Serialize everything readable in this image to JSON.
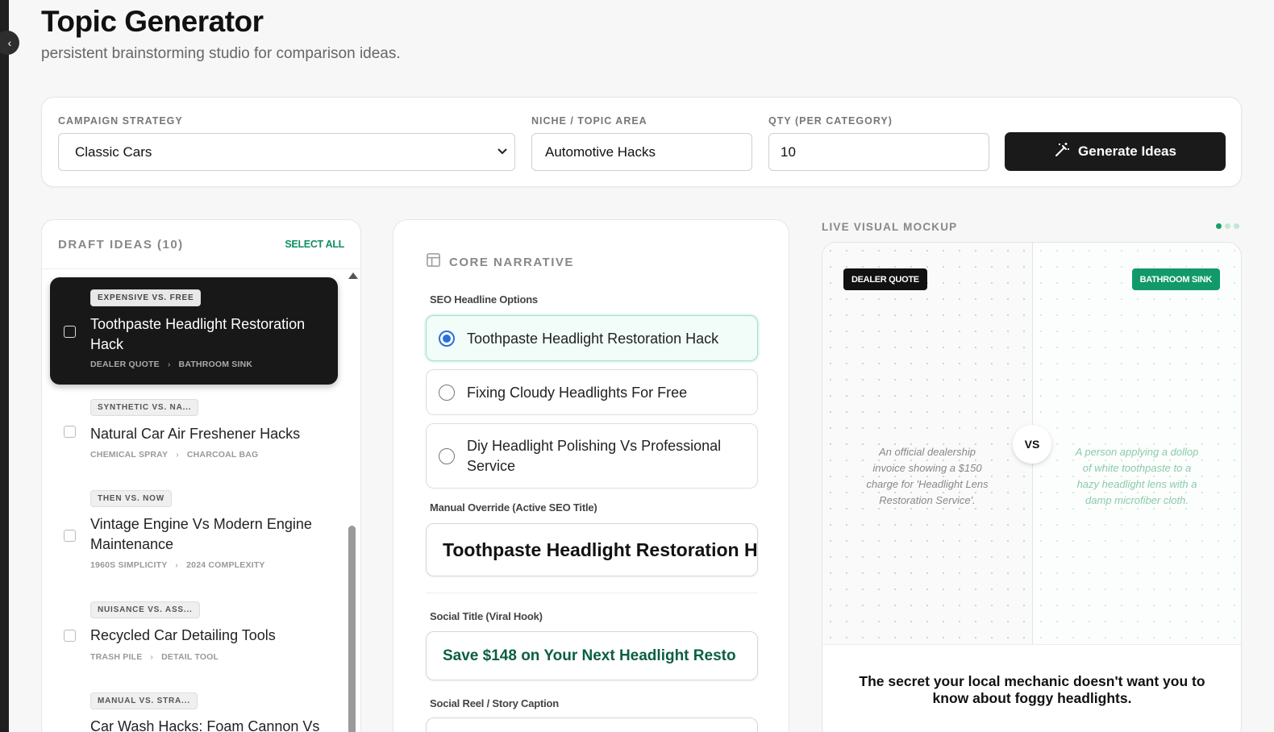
{
  "header": {
    "title": "Topic Generator",
    "subtitle": "persistent brainstorming studio for comparison ideas."
  },
  "controls": {
    "strategy_label": "CAMPAIGN STRATEGY",
    "strategy_value": "Classic Cars",
    "niche_label": "NICHE / TOPIC AREA",
    "niche_value": "Automotive Hacks",
    "qty_label": "QTY (PER CATEGORY)",
    "qty_value": "10",
    "generate_label": "Generate Ideas"
  },
  "drafts": {
    "title": "DRAFT IDEAS (10)",
    "select_all": "SELECT ALL",
    "items": [
      {
        "badge": "EXPENSIVE VS. FREE",
        "title": "Toothpaste Headlight Restoration Hack",
        "left": "DEALER QUOTE",
        "right": "BATHROOM SINK",
        "sep": "›"
      },
      {
        "badge": "SYNTHETIC VS. NA...",
        "title": "Natural Car Air Freshener Hacks",
        "left": "CHEMICAL SPRAY",
        "right": "CHARCOAL BAG",
        "sep": "›"
      },
      {
        "badge": "THEN VS. NOW",
        "title": "Vintage Engine Vs Modern Engine Maintenance",
        "left": "1960S SIMPLICITY",
        "right": "2024 COMPLEXITY",
        "sep": "›"
      },
      {
        "badge": "NUISANCE VS. ASS...",
        "title": "Recycled Car Detailing Tools",
        "left": "TRASH PILE",
        "right": "DETAIL TOOL",
        "sep": "›"
      },
      {
        "badge": "MANUAL VS. STRA...",
        "title": "Car Wash Hacks: Foam Cannon Vs",
        "left": "",
        "right": "",
        "sep": ""
      }
    ]
  },
  "narrative": {
    "title": "CORE NARRATIVE",
    "seo_label": "SEO Headline Options",
    "options": [
      "Toothpaste Headlight Restoration Hack",
      "Fixing Cloudy Headlights For Free",
      "Diy Headlight Polishing Vs Professional Service"
    ],
    "override_label": "Manual Override (Active SEO Title)",
    "override_value": "Toothpaste Headlight Restoration H",
    "social_label": "Social Title (Viral Hook)",
    "social_value": "Save $148 on Your Next Headlight Resto",
    "caption_label": "Social Reel / Story Caption"
  },
  "mockup": {
    "label": "LIVE VISUAL MOCKUP",
    "left_tag": "DEALER QUOTE",
    "right_tag": "BATHROOM SINK",
    "left_desc": "An official dealership invoice showing a $150 charge for 'Headlight Lens Restoration Service'.",
    "right_desc": "A person applying a dollop of white toothpaste to a hazy headlight lens with a damp microfiber cloth.",
    "vs": "VS",
    "hook": "The secret your local mechanic doesn't want you to know about foggy headlights."
  },
  "colors": {
    "accent_green": "#12996a",
    "dark": "#181818",
    "radio_blue": "#2a6fdb"
  }
}
